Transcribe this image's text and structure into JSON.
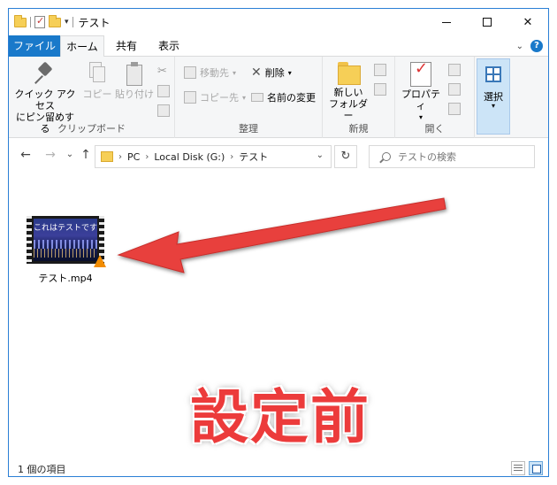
{
  "window": {
    "title": "テスト",
    "controls": {
      "minimize": "—",
      "maximize": "□",
      "close": "✕"
    }
  },
  "ribbon_tabs": [
    "ファイル",
    "ホーム",
    "共有",
    "表示"
  ],
  "ribbon": {
    "clipboard": {
      "group_label": "クリップボード",
      "pin_label_line1": "クイック アクセス",
      "pin_label_line2": "にピン留めする",
      "copy_label": "コピー",
      "paste_label": "貼り付け"
    },
    "organize": {
      "group_label": "整理",
      "move_to": "移動先",
      "copy_to": "コピー先",
      "delete": "削除",
      "rename": "名前の変更"
    },
    "new": {
      "group_label": "新規",
      "new_folder_line1": "新しい",
      "new_folder_line2": "フォルダー"
    },
    "open": {
      "group_label": "開く",
      "properties": "プロパティ"
    },
    "select": {
      "label": "選択"
    }
  },
  "address": {
    "crumbs": [
      "PC",
      "Local Disk (G:)",
      "テスト"
    ],
    "search_placeholder": "テストの検索"
  },
  "files": [
    {
      "name": "テスト.mp4",
      "thumbnail_caption": "これはテストです"
    }
  ],
  "overlay": {
    "label": "設定前",
    "color": "#ec3b3b"
  },
  "status": {
    "item_count": "1 個の項目"
  },
  "colors": {
    "accent": "#1979ca",
    "folder": "#f6cf57"
  }
}
